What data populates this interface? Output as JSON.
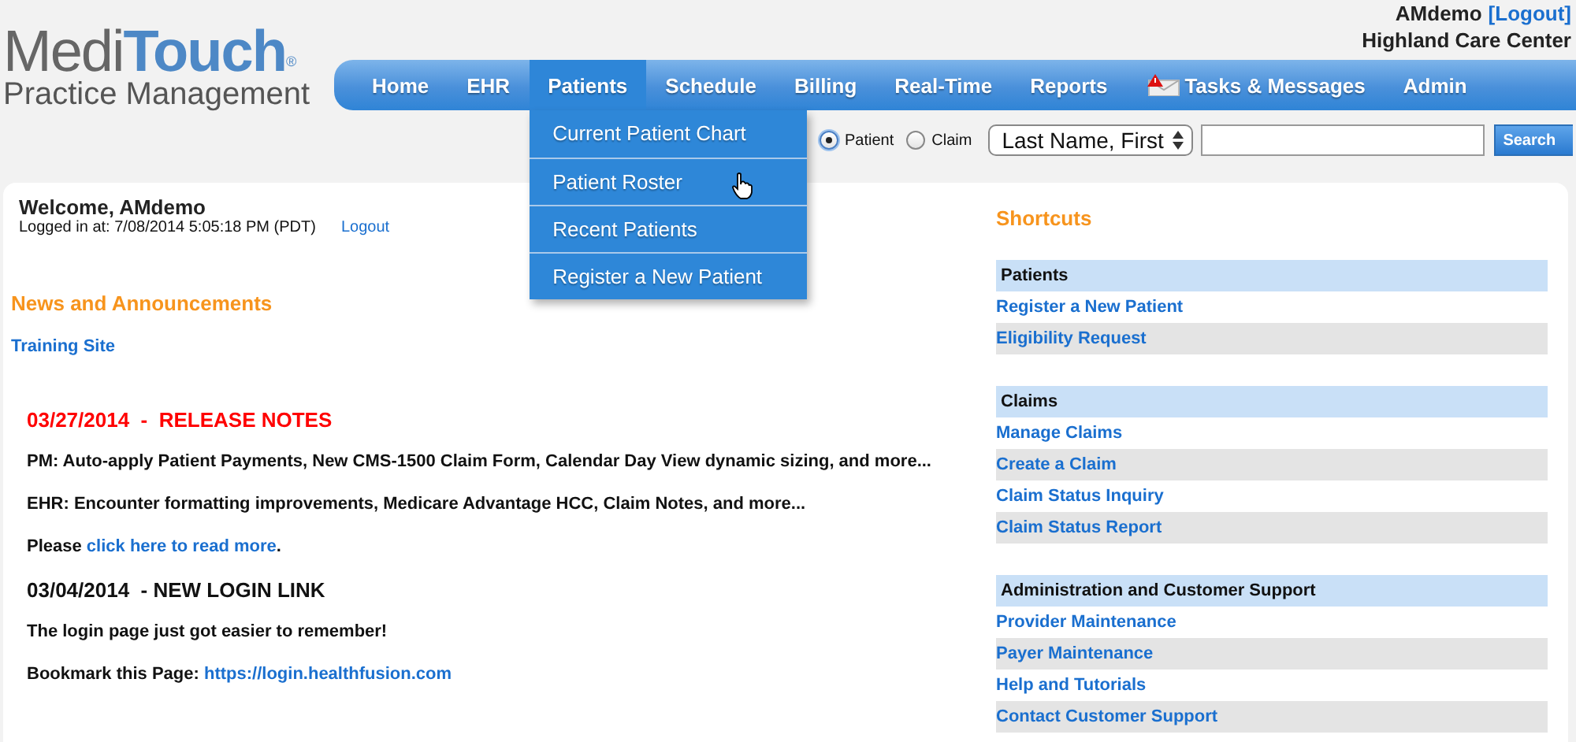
{
  "logo": {
    "part_1": "Medi",
    "part_2": "Touch",
    "mark": "®",
    "subtitle": "Practice Management"
  },
  "user": {
    "name": "AMdemo",
    "logout": "[Logout]",
    "facility": "Highland Care Center"
  },
  "nav": [
    {
      "label": "Home",
      "selected": false,
      "kind": "plain"
    },
    {
      "label": "EHR",
      "selected": false,
      "kind": "plain"
    },
    {
      "label": "Patients",
      "selected": true,
      "kind": "plain",
      "menu": [
        "Current Patient Chart",
        "Patient Roster",
        "Recent Patients",
        "Register a New Patient"
      ]
    },
    {
      "label": "Schedule",
      "selected": false,
      "kind": "plain"
    },
    {
      "label": "Billing",
      "selected": false,
      "kind": "plain"
    },
    {
      "label": "Real-Time",
      "selected": false,
      "kind": "plain"
    },
    {
      "label": "Reports",
      "selected": false,
      "kind": "plain"
    },
    {
      "label": "Tasks & Messages",
      "selected": false,
      "kind": "alert"
    },
    {
      "label": "Admin",
      "selected": false,
      "kind": "plain"
    }
  ],
  "search": {
    "options": [
      {
        "label": "Patient",
        "selected": true
      },
      {
        "label": "Claim",
        "selected": false
      }
    ],
    "field_select": "Last Name, First",
    "button": "Search"
  },
  "welcome": {
    "title": "Welcome, AMdemo",
    "login_info": "Logged in at: 7/08/2014 5:05:18 PM (PDT)",
    "logout": "Logout"
  },
  "news": {
    "heading": "News and Announcements",
    "training_link": "Training Site",
    "items": [
      {
        "kind": "alert-heading",
        "text": "03/27/2014  -  RELEASE NOTES"
      },
      {
        "kind": "paragraph",
        "text": "PM: Auto-apply Patient Payments, New CMS-1500 Claim Form, Calendar Day View dynamic sizing, and more..."
      },
      {
        "kind": "paragraph",
        "text": "EHR: Encounter formatting improvements, Medicare Advantage HCC, Claim Notes, and more..."
      },
      {
        "kind": "link-paragraph",
        "text": "Please ",
        "link": "click here to read more",
        "after": "."
      },
      {
        "kind": "heading",
        "text": "03/04/2014  - NEW LOGIN LINK"
      },
      {
        "kind": "paragraph",
        "text": "The login page just got easier to remember!"
      },
      {
        "kind": "link-paragraph",
        "text": "Bookmark this Page: ",
        "link": "https://login.healthfusion.com"
      }
    ]
  },
  "shortcuts": {
    "title": "Shortcuts",
    "groups": [
      {
        "heading": "Patients",
        "links": [
          "Register a New Patient",
          "Eligibility Request"
        ]
      },
      {
        "heading": "Claims",
        "links": [
          "Manage Claims",
          "Create a Claim",
          "Claim Status Inquiry",
          "Claim Status Report"
        ]
      },
      {
        "heading": "Administration and Customer Support",
        "links": [
          "Provider Maintenance",
          "Payer Maintenance",
          "Help and Tutorials",
          "Contact Customer Support"
        ]
      }
    ]
  }
}
